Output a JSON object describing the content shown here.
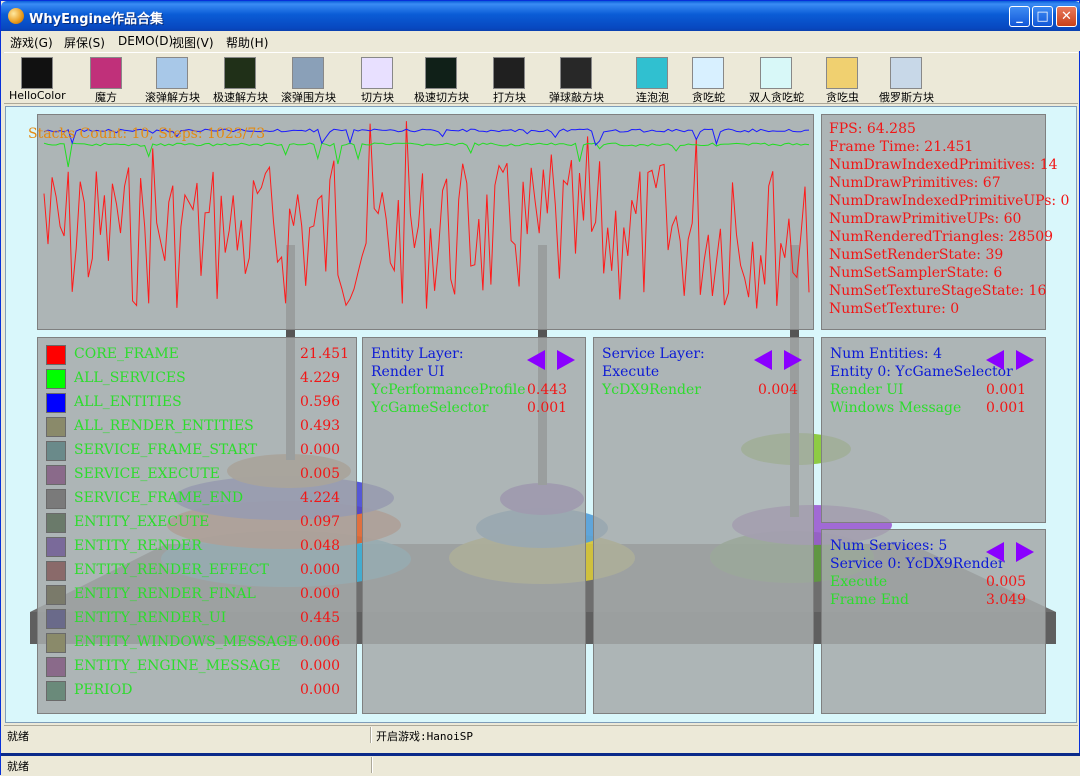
{
  "window": {
    "title": "WhyEngine作品合集",
    "min_label": "_",
    "max_label": "□",
    "close_label": "✕"
  },
  "menu": [
    "游戏(G)",
    "屏保(S)",
    "DEMO(D)",
    "视图(V)",
    "帮助(H)"
  ],
  "toolbar": [
    {
      "label": "HelloColor",
      "icon": "hellocolor-icon",
      "color": "#111111"
    },
    {
      "label": "魔方",
      "icon": "rubiks-cube-icon",
      "color": "#c0307a"
    },
    {
      "label": "滚弹解方块",
      "icon": "rolling-ball-icon",
      "color": "#a8c8e8"
    },
    {
      "label": "极速解方块",
      "icon": "speed-block-icon",
      "color": "#203018"
    },
    {
      "label": "滚弹围方块",
      "icon": "ball-surround-icon",
      "color": "#8aa0b8"
    },
    {
      "label": "切方块",
      "icon": "cut-block-icon",
      "color": "#e8e0ff"
    },
    {
      "label": "极速切方块",
      "icon": "speed-cut-icon",
      "color": "#102018"
    },
    {
      "label": "打方块",
      "icon": "hit-block-icon",
      "color": "#202020"
    },
    {
      "label": "弹球敲方块",
      "icon": "pinball-block-icon",
      "color": "#282828"
    },
    {
      "label": "连泡泡",
      "icon": "bubble-icon",
      "color": "#30c0d0"
    },
    {
      "label": "贪吃蛇",
      "icon": "snake-icon",
      "color": "#d8f0ff"
    },
    {
      "label": "双人贪吃蛇",
      "icon": "two-snake-icon",
      "color": "#d8f8f8"
    },
    {
      "label": "贪吃虫",
      "icon": "worm-icon",
      "color": "#f0d070"
    },
    {
      "label": "俄罗斯方块",
      "icon": "tetris-icon",
      "color": "#c8d8e8"
    }
  ],
  "overlay": {
    "stack_info": "Stacks Count: 10, Steps: 1023/73"
  },
  "stats": [
    "FPS: 64.285",
    "Frame Time: 21.451",
    "NumDrawIndexedPrimitives: 14",
    "NumDrawPrimitives: 67",
    "NumDrawIndexedPrimitiveUPs: 0",
    "NumDrawPrimitiveUPs: 60",
    "NumRenderedTriangles: 28509",
    "NumSetRenderState: 39",
    "NumSetSamplerState: 6",
    "NumSetTextureStageState: 16",
    "NumSetTexture: 0"
  ],
  "profile": [
    {
      "name": "CORE_FRAME",
      "value": "21.451",
      "color": "#ff0000"
    },
    {
      "name": "ALL_SERVICES",
      "value": "4.229",
      "color": "#00ff00"
    },
    {
      "name": "ALL_ENTITIES",
      "value": "0.596",
      "color": "#0000ff"
    },
    {
      "name": "ALL_RENDER_ENTITIES",
      "value": "0.493",
      "color": "#8a8a6a"
    },
    {
      "name": "SERVICE_FRAME_START",
      "value": "0.000",
      "color": "#6a8a8a"
    },
    {
      "name": "SERVICE_EXECUTE",
      "value": "0.005",
      "color": "#8a6a8a"
    },
    {
      "name": "SERVICE_FRAME_END",
      "value": "4.224",
      "color": "#7a7a7a"
    },
    {
      "name": "ENTITY_EXECUTE",
      "value": "0.097",
      "color": "#6a7a6a"
    },
    {
      "name": "ENTITY_RENDER",
      "value": "0.048",
      "color": "#7a6a9a"
    },
    {
      "name": "ENTITY_RENDER_EFFECT",
      "value": "0.000",
      "color": "#8a6a6a"
    },
    {
      "name": "ENTITY_RENDER_FINAL",
      "value": "0.000",
      "color": "#7a7a6a"
    },
    {
      "name": "ENTITY_RENDER_UI",
      "value": "0.445",
      "color": "#6a6a8a"
    },
    {
      "name": "ENTITY_WINDOWS_MESSAGE",
      "value": "0.006",
      "color": "#8a8a6a"
    },
    {
      "name": "ENTITY_ENGINE_MESSAGE",
      "value": "0.000",
      "color": "#8a6a8a"
    },
    {
      "name": "PERIOD",
      "value": "0.000",
      "color": "#6a8a7a"
    }
  ],
  "entity_layer": {
    "title": "Entity Layer:",
    "sub": "Render UI",
    "rows": [
      {
        "name": "YcPerformanceProfile",
        "value": "0.443"
      },
      {
        "name": "YcGameSelector",
        "value": "0.001"
      }
    ]
  },
  "service_layer": {
    "title": "Service Layer:",
    "sub": "Execute",
    "rows": [
      {
        "name": "YcDX9Render",
        "value": "0.004"
      }
    ]
  },
  "entities_panel": {
    "title": "Num Entities: 4",
    "sub": "Entity 0: YcGameSelector",
    "rows": [
      {
        "name": "Render UI",
        "value": "0.001"
      },
      {
        "name": "Windows Message",
        "value": "0.001"
      }
    ]
  },
  "services_panel": {
    "title": "Num Services: 5",
    "sub": "Service 0: YcDX9Render",
    "rows": [
      {
        "name": "Execute",
        "value": "0.005"
      },
      {
        "name": "Frame End",
        "value": "3.049"
      }
    ]
  },
  "status": {
    "ready": "就绪",
    "game": "开启游戏:HanoiSP",
    "ready2": "就绪"
  }
}
